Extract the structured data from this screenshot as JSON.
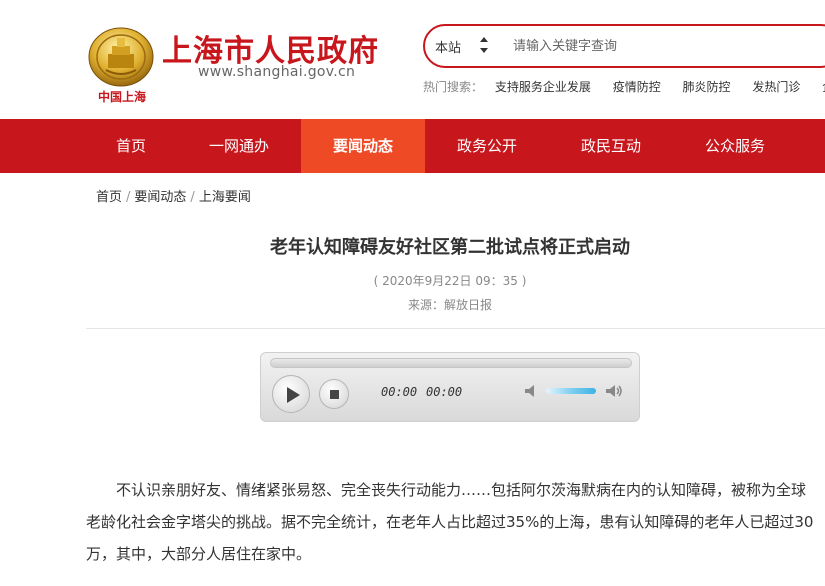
{
  "header": {
    "logo_caption": "中国上海",
    "site_title": "上海市人民政府",
    "site_url": "www.shanghai.gov.cn"
  },
  "search": {
    "scope": "本站",
    "placeholder": "请输入关键字查询",
    "value": ""
  },
  "hot_search": {
    "label": "热门搜索：",
    "items": [
      "支持服务企业发展",
      "疫情防控",
      "肺炎防控",
      "发热门诊",
      "企业"
    ]
  },
  "nav": {
    "items": [
      "首页",
      "一网通办",
      "要闻动态",
      "政务公开",
      "政民互动",
      "公众服务"
    ],
    "active": "要闻动态"
  },
  "breadcrumb": [
    "首页",
    "要闻动态",
    "上海要闻"
  ],
  "article": {
    "title": "老年认知障碍友好社区第二批试点将正式启动",
    "date": "( 2020年9月22日 09：35 )",
    "source": "来源：解放日报",
    "body": "不认识亲朋好友、情绪紧张易怒、完全丧失行动能力……包括阿尔茨海默病在内的认知障碍，被称为全球老龄化社会金字塔尖的挑战。据不完全统计，在老年人占比超过35%的上海，患有认知障碍的老年人已超过30万，其中，大部分人居住在家中。"
  },
  "player": {
    "current_time": "00:00",
    "duration": "00:00",
    "volume": 0.7
  },
  "colors": {
    "brand_red": "#c8161d",
    "nav_active": "#ef4a26"
  }
}
